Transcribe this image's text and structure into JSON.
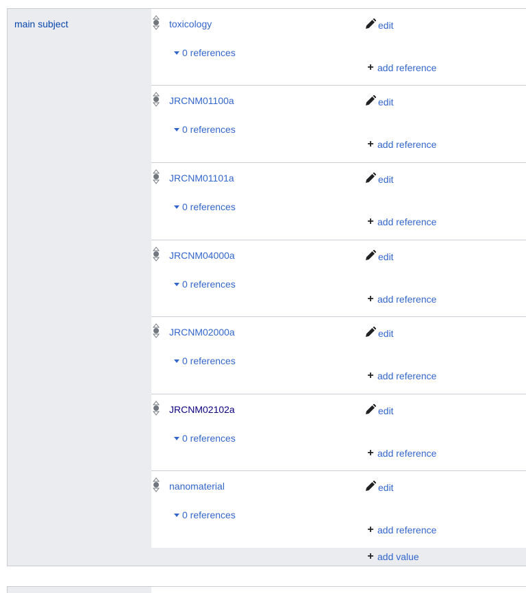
{
  "property": {
    "label": "main subject"
  },
  "statements": [
    {
      "value": "toxicology",
      "edit_label": "edit",
      "references_label": "0 references",
      "add_reference_label": "add reference"
    },
    {
      "value": "JRCNM01100a",
      "edit_label": "edit",
      "references_label": "0 references",
      "add_reference_label": "add reference"
    },
    {
      "value": "JRCNM01101a",
      "edit_label": "edit",
      "references_label": "0 references",
      "add_reference_label": "add reference"
    },
    {
      "value": "JRCNM04000a",
      "edit_label": "edit",
      "references_label": "0 references",
      "add_reference_label": "add reference"
    },
    {
      "value": "JRCNM02000a",
      "edit_label": "edit",
      "references_label": "0 references",
      "add_reference_label": "add reference"
    },
    {
      "value": "JRCNM02102a",
      "edit_label": "edit",
      "references_label": "0 references",
      "add_reference_label": "add reference"
    },
    {
      "value": "nanomaterial",
      "edit_label": "edit",
      "references_label": "0 references",
      "add_reference_label": "add reference"
    }
  ],
  "add_value_label": "add value",
  "colors": {
    "link": "#3366cc",
    "visited_link": "#0b0080",
    "label": "#0645ad",
    "panel": "#eaecf0",
    "border": "#c8ccd1"
  },
  "icons": {
    "rank": "normal-rank-icon",
    "edit": "pencil-icon",
    "add": "plus-icon",
    "expand": "triangle-down-icon"
  }
}
